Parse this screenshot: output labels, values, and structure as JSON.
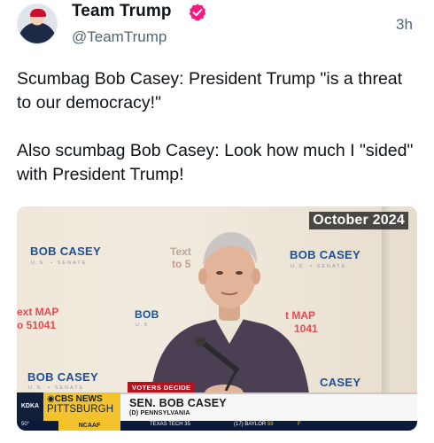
{
  "author": {
    "display_name": "Team Trump",
    "handle": "@TeamTrump",
    "verified_badge_color": "#f91880"
  },
  "timestamp": "3h",
  "tweet": {
    "paragraph_1": "Scumbag Bob Casey: President Trump \"is a threat to our democracy!\"",
    "paragraph_2": "Also scumbag Bob Casey: Look how much I \"sided\" with President Trump!"
  },
  "media": {
    "date_overlay": "October 2024",
    "signs": {
      "casey_left_top": "BOB CASEY",
      "casey_left_top_sub": "U.S. • SENATE",
      "casey_right_top": "BOB CASEY",
      "casey_right_top_sub": "U.S. • SENATE",
      "text_partial": "Text",
      "to_partial": "to 5",
      "ext_map": "ext MAP",
      "ext_num": "o 51041",
      "bob_partial": "BOB",
      "us_partial": "U.S.",
      "t_map": "t MAP",
      "num_right": "1041",
      "casey_left_bottom": "BOB CASEY",
      "casey_left_bottom_sub": "U.S. • SENATE",
      "casey_right_bottom": "CASEY"
    },
    "lower_third": {
      "tag": "VOTERS DECIDE",
      "name": "SEN. BOB CASEY",
      "subtitle": "(D) PENNSYLVANIA",
      "station_call": "KDKA",
      "network": "CBS NEWS",
      "city": "PITTSBURGH"
    },
    "ticker": {
      "temp": "50°",
      "category": "NCAAF",
      "team_1": "TEXAS TECH",
      "score_1": "35",
      "team_2_rank": "(17)",
      "team_2": "BAYLOR",
      "score_2": "59",
      "status": "F"
    }
  }
}
